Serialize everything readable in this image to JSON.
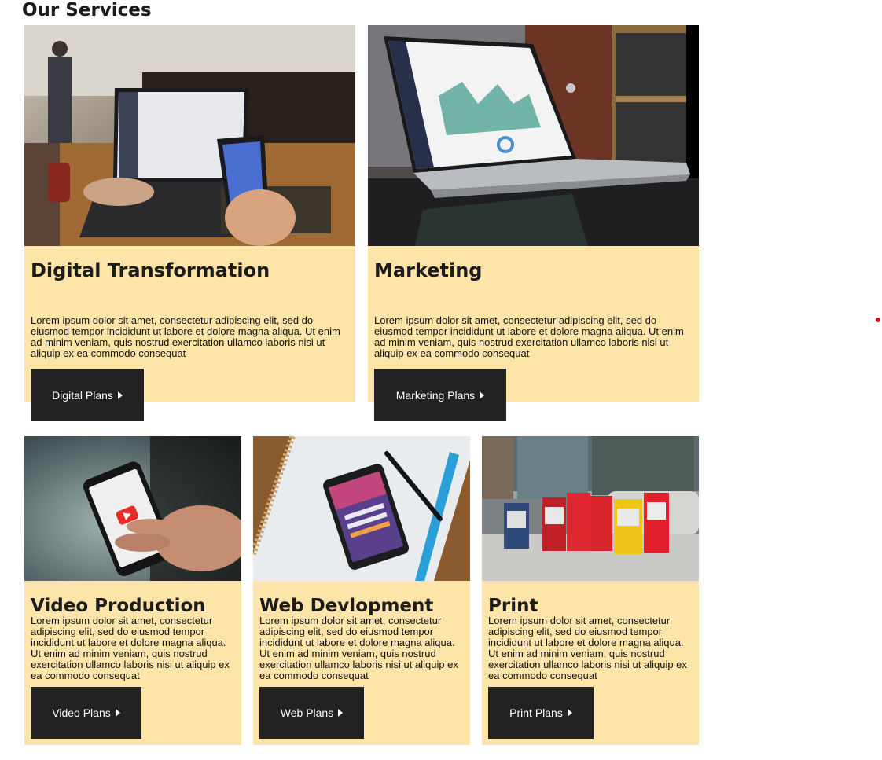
{
  "page": {
    "title": "Our Services"
  },
  "colors": {
    "card_background": "#fde5a9",
    "button_background": "#222222",
    "heading": "#1c1c1c",
    "dot": "#d3121c"
  },
  "services": [
    {
      "title": "Digital Transformation",
      "text": "Lorem ipsum dolor sit amet, consectetur adipiscing elit, sed do eiusmod tempor incididunt ut labore et dolore magna aliqua. Ut enim ad minim veniam, quis nostrud exercitation ullamco laboris nisi ut aliquip ex ea commodo consequat",
      "button_label": "Digital Plans",
      "image": "laptop-and-phone-photo"
    },
    {
      "title": "Marketing",
      "text": "Lorem ipsum dolor sit amet, consectetur adipiscing elit, sed do eiusmod tempor incididunt ut labore et dolore magna aliqua. Ut enim ad minim veniam, quis nostrud exercitation ullamco laboris nisi ut aliquip ex ea commodo consequat",
      "button_label": "Marketing Plans",
      "image": "laptop-analytics-dashboard-photo"
    },
    {
      "title": "Video Production",
      "text": "Lorem ipsum dolor sit amet, consectetur adipiscing elit, sed do eiusmod tempor incididunt ut labore et dolore magna aliqua. Ut enim ad minim veniam, quis nostrud exercitation ullamco laboris nisi ut aliquip ex ea commodo consequat",
      "button_label": "Video Plans",
      "image": "phone-video-play-photo"
    },
    {
      "title": "Web Devlopment",
      "text": "Lorem ipsum dolor sit amet, consectetur adipiscing elit, sed do eiusmod tempor incididunt ut labore et dolore magna aliqua. Ut enim ad minim veniam, quis nostrud exercitation ullamco laboris nisi ut aliquip ex ea commodo consequat",
      "button_label": "Web Plans",
      "image": "phone-on-notebook-photo"
    },
    {
      "title": "Print",
      "text": "Lorem ipsum dolor sit amet, consectetur adipiscing elit, sed do eiusmod tempor incididunt ut labore et dolore magna aliqua. Ut enim ad minim veniam, quis nostrud exercitation ullamco laboris nisi ut aliquip ex ea commodo consequat",
      "button_label": "Print Plans",
      "image": "newspaper-boxes-street-photo"
    }
  ]
}
